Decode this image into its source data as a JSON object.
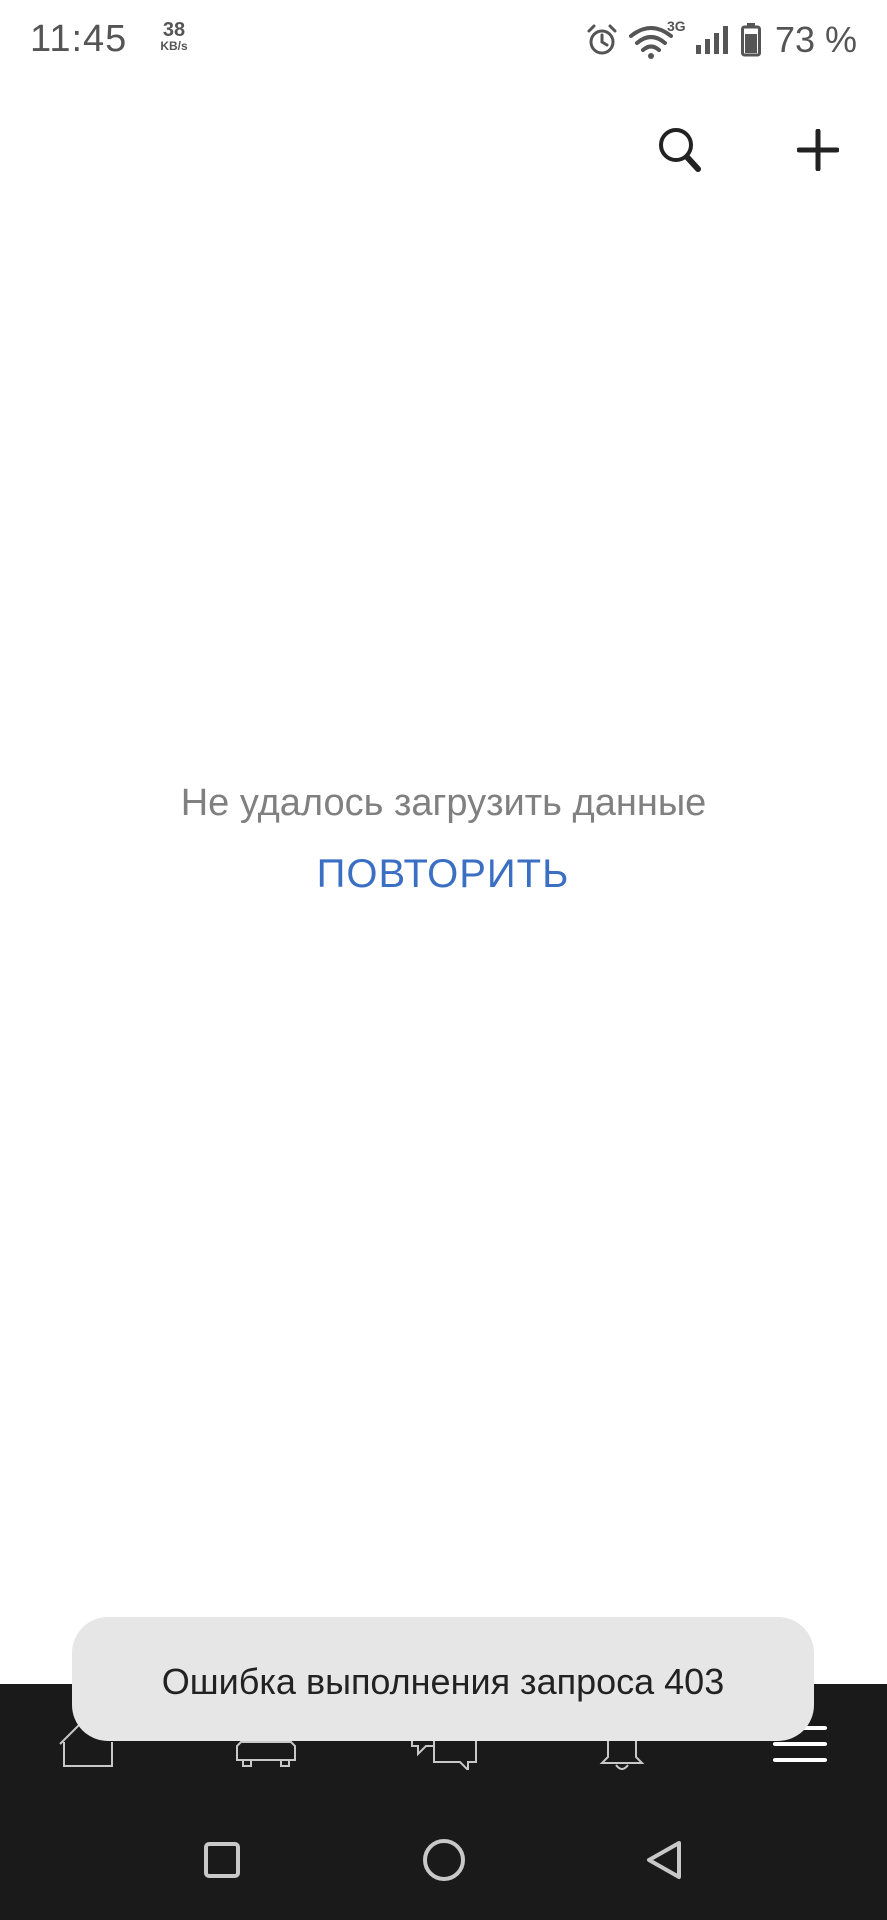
{
  "status_bar": {
    "time": "11:45",
    "speed_value": "38",
    "speed_unit": "KB/s",
    "network_type": "3G",
    "battery": "73 %"
  },
  "top_bar": {
    "icons": [
      "search-icon",
      "plus-icon"
    ]
  },
  "empty_state": {
    "message": "Не удалось загрузить данные",
    "retry_label": "ПОВТОРИТЬ",
    "retry_color": "#3a6fc4"
  },
  "toast": {
    "message": "Ошибка выполнения запроса 403"
  },
  "bottom_nav": {
    "items": [
      "home-icon",
      "car-icon",
      "chat-icon",
      "bell-icon",
      "menu-icon"
    ],
    "background": "#1a1a1a"
  },
  "system_nav": {
    "items": [
      "recents-icon",
      "home-circle-icon",
      "back-icon"
    ]
  }
}
